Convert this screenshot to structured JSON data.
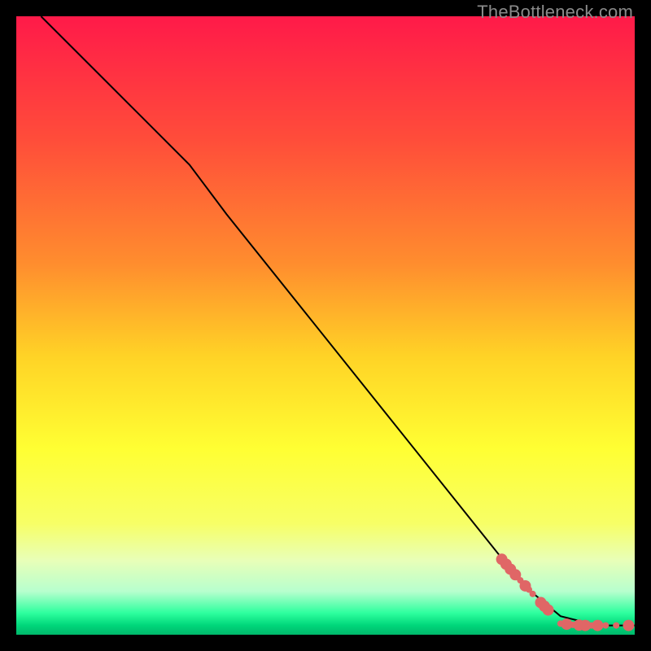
{
  "watermark": "TheBottleneck.com",
  "chart_data": {
    "type": "line",
    "title": "",
    "xlabel": "",
    "ylabel": "",
    "xlim": [
      0,
      100
    ],
    "ylim": [
      0,
      100
    ],
    "background_gradient": {
      "stops": [
        {
          "offset": 0.0,
          "color": "#ff1a49"
        },
        {
          "offset": 0.2,
          "color": "#ff4d3a"
        },
        {
          "offset": 0.4,
          "color": "#ff8d2e"
        },
        {
          "offset": 0.55,
          "color": "#ffd326"
        },
        {
          "offset": 0.7,
          "color": "#ffff33"
        },
        {
          "offset": 0.82,
          "color": "#f7ff66"
        },
        {
          "offset": 0.88,
          "color": "#e8ffb8"
        },
        {
          "offset": 0.93,
          "color": "#b7ffce"
        },
        {
          "offset": 0.965,
          "color": "#2dff9e"
        },
        {
          "offset": 0.985,
          "color": "#00d67a"
        },
        {
          "offset": 1.0,
          "color": "#00b86b"
        }
      ]
    },
    "series": [
      {
        "name": "curve",
        "type": "line",
        "color": "#000000",
        "width": 2,
        "points": [
          {
            "x": 4.0,
            "y": 100.0
          },
          {
            "x": 20.0,
            "y": 84.0
          },
          {
            "x": 28.0,
            "y": 76.0
          },
          {
            "x": 34.0,
            "y": 68.0
          },
          {
            "x": 82.0,
            "y": 8.0
          },
          {
            "x": 88.0,
            "y": 3.0
          },
          {
            "x": 94.0,
            "y": 1.5
          },
          {
            "x": 100.0,
            "y": 1.5
          }
        ]
      },
      {
        "name": "upper-points",
        "type": "scatter",
        "color": "#e06666",
        "radius_small": 4,
        "radius_large": 7,
        "points": [
          {
            "x": 78.5,
            "y": 12.2,
            "r": 7
          },
          {
            "x": 79.2,
            "y": 11.4,
            "r": 7
          },
          {
            "x": 79.9,
            "y": 10.6,
            "r": 7
          },
          {
            "x": 80.7,
            "y": 9.7,
            "r": 7
          },
          {
            "x": 81.5,
            "y": 8.8,
            "r": 4
          },
          {
            "x": 82.3,
            "y": 7.9,
            "r": 7
          },
          {
            "x": 82.9,
            "y": 7.3,
            "r": 4
          },
          {
            "x": 83.5,
            "y": 6.6,
            "r": 4
          },
          {
            "x": 84.8,
            "y": 5.2,
            "r": 7
          },
          {
            "x": 85.4,
            "y": 4.6,
            "r": 7
          },
          {
            "x": 86.0,
            "y": 4.0,
            "r": 7
          }
        ]
      },
      {
        "name": "lower-points",
        "type": "scatter",
        "color": "#e06666",
        "radius_small": 4,
        "radius_large": 7,
        "points": [
          {
            "x": 88.0,
            "y": 1.8,
            "r": 4
          },
          {
            "x": 89.0,
            "y": 1.7,
            "r": 7
          },
          {
            "x": 90.0,
            "y": 1.6,
            "r": 4
          },
          {
            "x": 91.0,
            "y": 1.55,
            "r": 7
          },
          {
            "x": 92.0,
            "y": 1.5,
            "r": 7
          },
          {
            "x": 93.0,
            "y": 1.5,
            "r": 4
          },
          {
            "x": 94.0,
            "y": 1.5,
            "r": 7
          },
          {
            "x": 95.3,
            "y": 1.5,
            "r": 4
          },
          {
            "x": 97.0,
            "y": 1.5,
            "r": 4
          },
          {
            "x": 99.0,
            "y": 1.5,
            "r": 7
          }
        ]
      }
    ]
  }
}
